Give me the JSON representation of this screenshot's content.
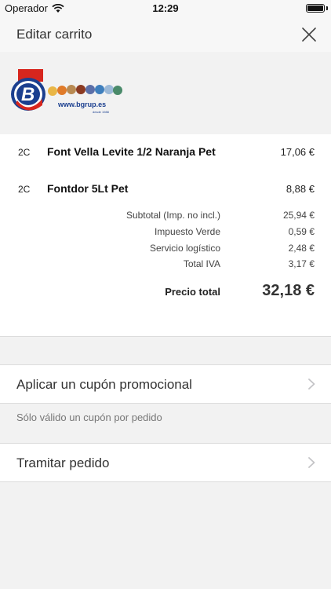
{
  "status_bar": {
    "carrier": "Operador",
    "time": "12:29"
  },
  "nav": {
    "title": "Editar carrito"
  },
  "logo": {
    "url_text": "www.bgrup.es",
    "since_text": "desde 1988"
  },
  "items": [
    {
      "qty": "2C",
      "name": "Font Vella Levite 1/2 Naranja Pet",
      "price": "17,06 €"
    },
    {
      "qty": "2C",
      "name": "Fontdor 5Lt Pet",
      "price": "8,88 €"
    }
  ],
  "summary": [
    {
      "label": "Subtotal (Imp. no incl.)",
      "value": "25,94 €"
    },
    {
      "label": "Impuesto Verde",
      "value": "0,59 €"
    },
    {
      "label": "Servicio logístico",
      "value": "2,48 €"
    },
    {
      "label": "Total IVA",
      "value": "3,17 €"
    }
  ],
  "total": {
    "label": "Precio total",
    "value": "32,18 €"
  },
  "coupon": {
    "label": "Aplicar un cupón promocional",
    "note": "Sólo válido un cupón por pedido"
  },
  "checkout": {
    "label": "Tramitar pedido"
  },
  "colors": {
    "background": "#f2f2f2",
    "card": "#ffffff",
    "brand_blue": "#1b3f8f",
    "brand_red": "#d7261e"
  }
}
